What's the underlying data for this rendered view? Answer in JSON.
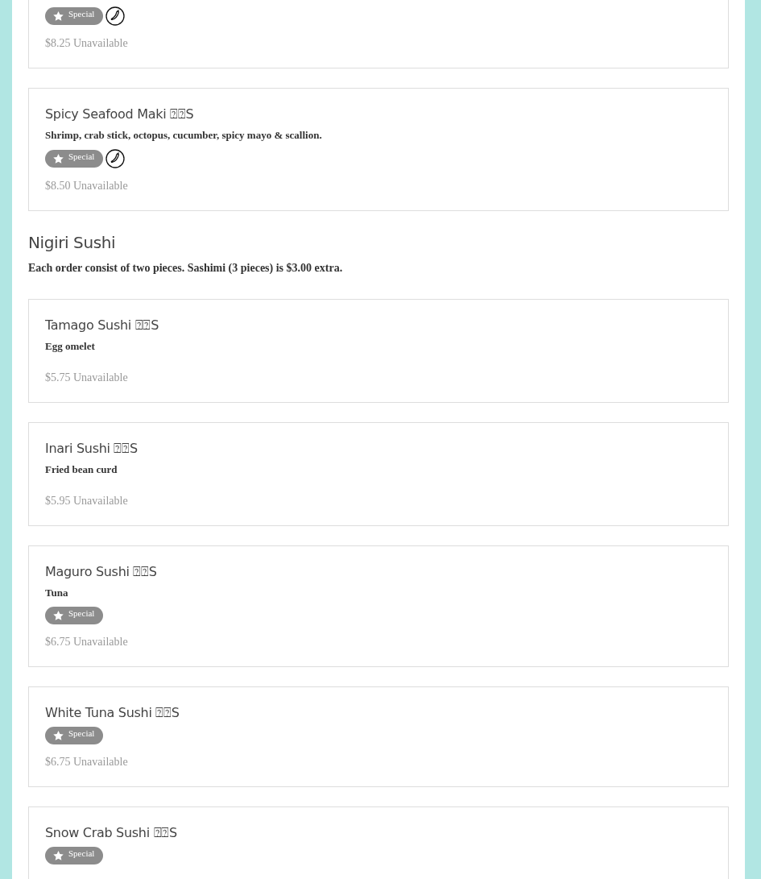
{
  "sections": [
    {
      "items": [
        {
          "clipped": true,
          "special": "Special",
          "spicy": true,
          "price": "$8.25",
          "status": "Unavailable"
        },
        {
          "name": "Spicy Seafood Maki ⍰⍰S",
          "description": "Shrimp, crab stick, octopus, cucumber, spicy mayo & scallion.",
          "special": "Special",
          "spicy": true,
          "price": "$8.50",
          "status": "Unavailable"
        }
      ]
    },
    {
      "title": "Nigiri Sushi",
      "note": "Each order consist of two pieces. Sashimi (3 pieces) is $3.00 extra.",
      "items": [
        {
          "name": "Tamago Sushi ⍰⍰S",
          "description": "Egg omelet",
          "spicy": false,
          "price": "$5.75",
          "status": "Unavailable"
        },
        {
          "name": "Inari Sushi ⍰⍰S",
          "description": "Fried bean curd",
          "spicy": false,
          "price": "$5.95",
          "status": "Unavailable"
        },
        {
          "name": "Maguro Sushi ⍰⍰S",
          "description": "Tuna",
          "special": "Special",
          "spicy": false,
          "price": "$6.75",
          "status": "Unavailable"
        },
        {
          "name": "White Tuna Sushi ⍰⍰S",
          "special": "Special",
          "spicy": false,
          "price": "$6.75",
          "status": "Unavailable"
        },
        {
          "name": "Snow Crab Sushi ⍰⍰S",
          "special": "Special",
          "spicy": false
        }
      ]
    }
  ]
}
